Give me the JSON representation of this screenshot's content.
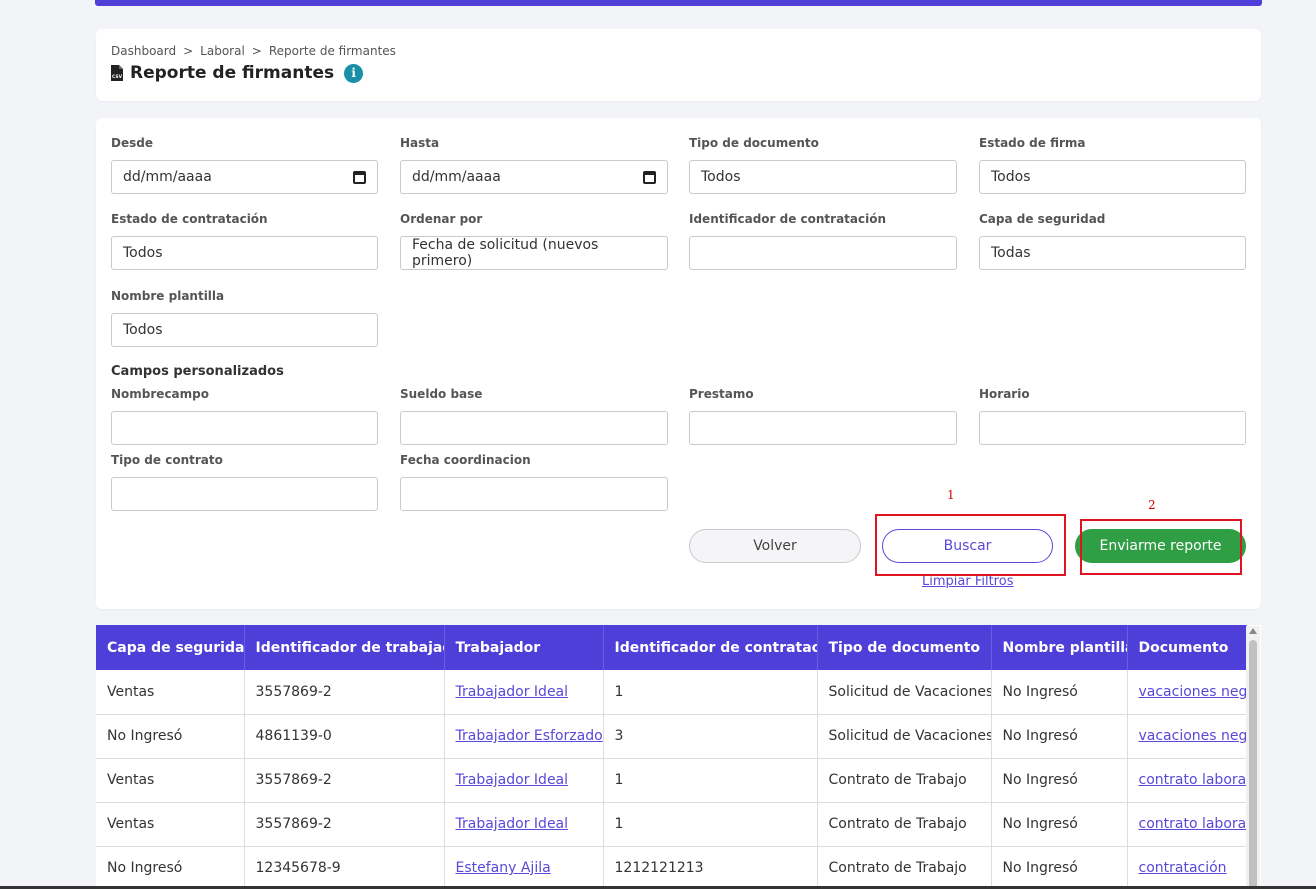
{
  "breadcrumb": {
    "items": [
      "Dashboard",
      "Laboral",
      "Reporte de firmantes"
    ],
    "separator": ">"
  },
  "page": {
    "title": "Reporte de firmantes",
    "info_glyph": "i",
    "csv_icon_text": "CSV"
  },
  "filters": {
    "desde": {
      "label": "Desde",
      "value": "dd/mm/aaaa"
    },
    "hasta": {
      "label": "Hasta",
      "value": "dd/mm/aaaa"
    },
    "tipo_documento": {
      "label": "Tipo de documento",
      "value": "Todos"
    },
    "estado_firma": {
      "label": "Estado de firma",
      "value": "Todos"
    },
    "estado_contratacion": {
      "label": "Estado de contratación",
      "value": "Todos"
    },
    "ordenar_por": {
      "label": "Ordenar por",
      "value": "Fecha de solicitud (nuevos primero)"
    },
    "identificador_contratacion": {
      "label": "Identificador de contratación",
      "value": ""
    },
    "capa_seguridad": {
      "label": "Capa de seguridad",
      "value": "Todas"
    },
    "nombre_plantilla": {
      "label": "Nombre plantilla",
      "value": "Todos"
    }
  },
  "custom_fields": {
    "title": "Campos personalizados",
    "nombrecampo": {
      "label": "Nombrecampo",
      "value": ""
    },
    "sueldo_base": {
      "label": "Sueldo base",
      "value": ""
    },
    "prestamo": {
      "label": "Prestamo",
      "value": ""
    },
    "horario": {
      "label": "Horario",
      "value": ""
    },
    "tipo_contrato": {
      "label": "Tipo de contrato",
      "value": ""
    },
    "fecha_coordinacion": {
      "label": "Fecha coordinacion",
      "value": ""
    }
  },
  "actions": {
    "volver": "Volver",
    "buscar": "Buscar",
    "enviar": "Enviarme reporte",
    "limpiar": "Limpiar Filtros"
  },
  "annotations": {
    "one": "1",
    "two": "2",
    "color": "#e0141e"
  },
  "colors": {
    "accent": "#4e3fd8",
    "success": "#2f9e44",
    "link": "#5a48d8",
    "info": "#1a8fa8"
  },
  "table": {
    "headers": [
      "Capa de seguridad",
      "Identificador de trabajador",
      "Trabajador",
      "Identificador de contratación",
      "Tipo de documento",
      "Nombre plantilla",
      "Documento"
    ],
    "rows": [
      [
        "Ventas",
        "3557869-2",
        "Trabajador Ideal",
        "1",
        "Solicitud de Vacaciones",
        "No Ingresó",
        "vacaciones nego"
      ],
      [
        "No Ingresó",
        "4861139-0",
        "Trabajador Esforzado",
        "3",
        "Solicitud de Vacaciones",
        "No Ingresó",
        "vacaciones nego"
      ],
      [
        "Ventas",
        "3557869-2",
        "Trabajador Ideal",
        "1",
        "Contrato de Trabajo",
        "No Ingresó",
        "contrato laboral"
      ],
      [
        "Ventas",
        "3557869-2",
        "Trabajador Ideal",
        "1",
        "Contrato de Trabajo",
        "No Ingresó",
        "contrato laboral"
      ],
      [
        "No Ingresó",
        "12345678-9",
        "Estefany Ajila",
        "1212121213",
        "Contrato de Trabajo",
        "No Ingresó",
        "contratación"
      ]
    ]
  }
}
